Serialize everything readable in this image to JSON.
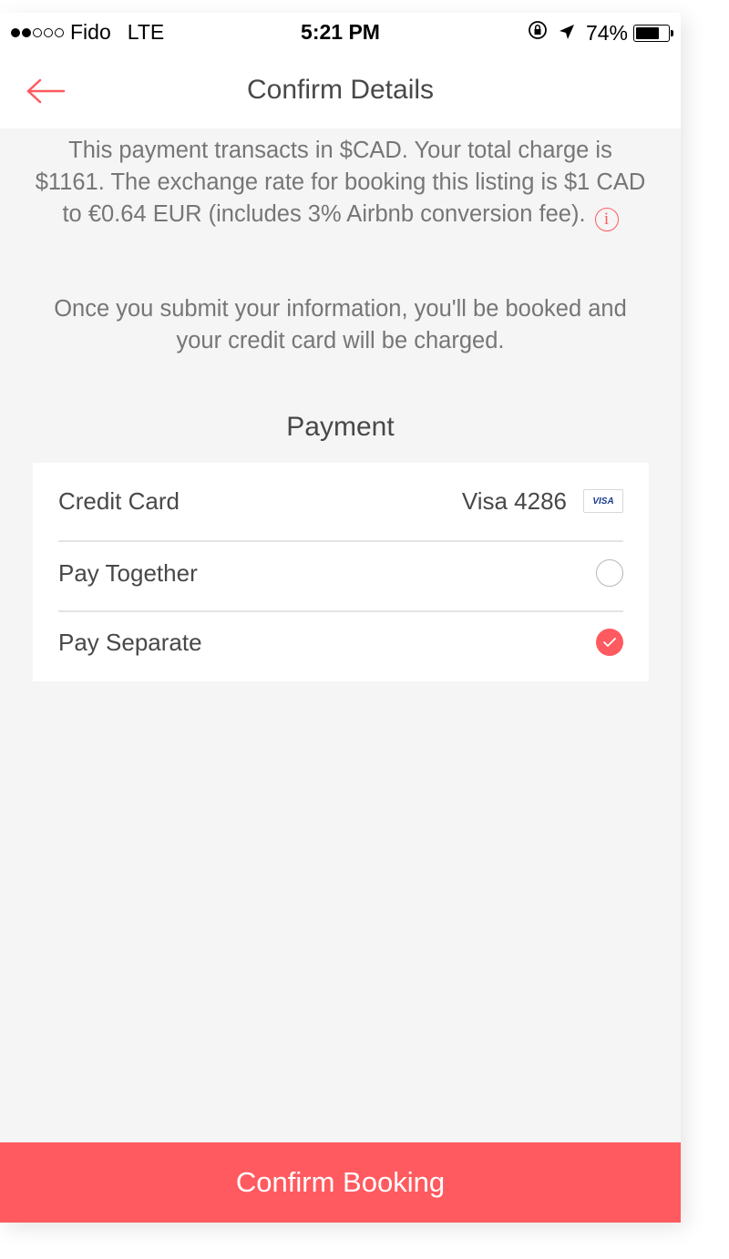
{
  "status_bar": {
    "carrier": "Fido",
    "network": "LTE",
    "time": "5:21 PM",
    "battery": "74%",
    "battery_level": 0.74,
    "signal_bars_filled": 2,
    "signal_bars_total": 5
  },
  "nav": {
    "title": "Confirm Details",
    "back_icon": "arrow-left-icon"
  },
  "notice": {
    "exchange_text": "This payment transacts in $CAD. Your total charge is $1161. The exchange rate for booking this listing is $1 CAD to €0.64 EUR (includes 3% Airbnb conversion fee).",
    "info_icon": "info-circle-icon",
    "booking_text": "Once you submit your information, you'll be booked and your credit card will be charged."
  },
  "payment": {
    "title": "Payment",
    "credit_card_label": "Credit Card",
    "card_value": "Visa 4286",
    "card_brand": "VISA",
    "options": [
      {
        "label": "Pay Together",
        "selected": false
      },
      {
        "label": "Pay Separate",
        "selected": true
      }
    ]
  },
  "confirm_button": "Confirm Booking",
  "colors": {
    "accent": "#ff5a5f",
    "text": "#484848",
    "muted_text": "#767676",
    "background": "#f5f5f5"
  }
}
